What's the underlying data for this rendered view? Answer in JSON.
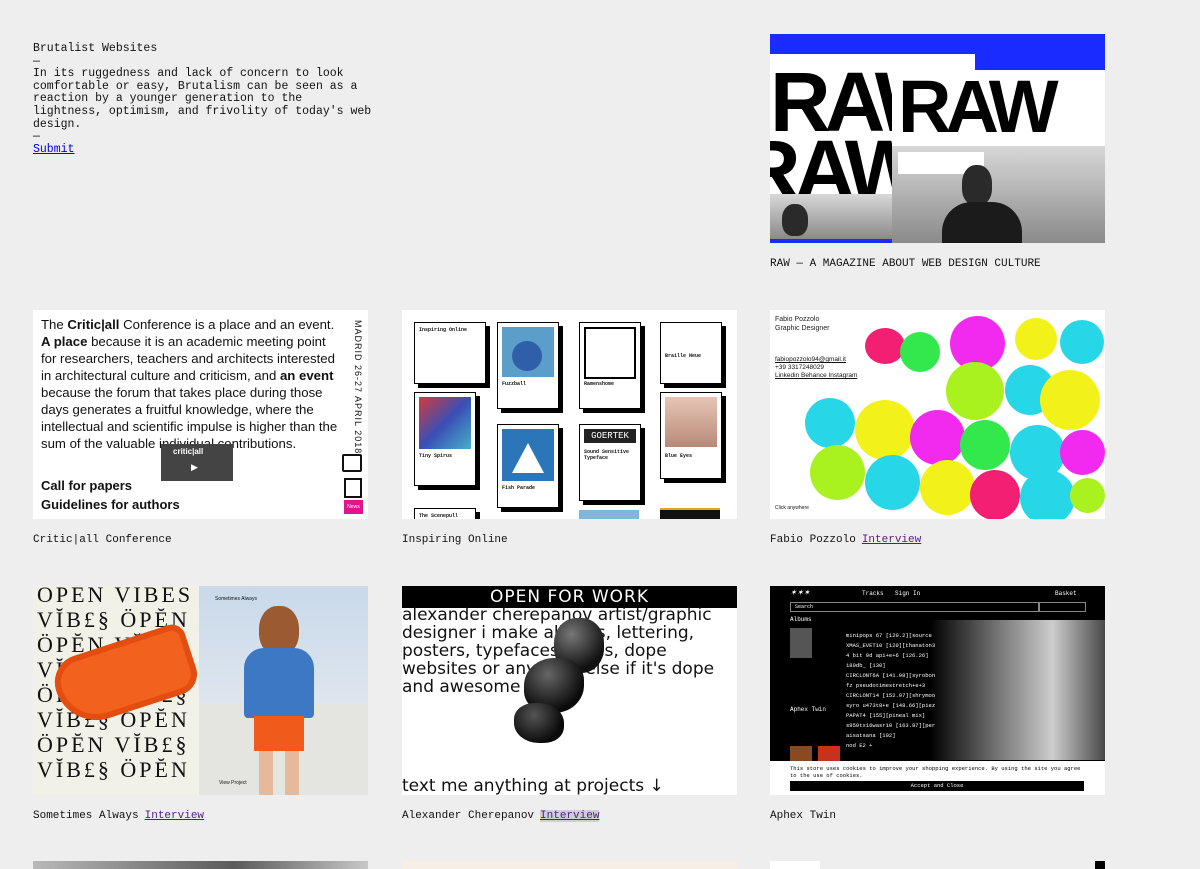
{
  "intro": {
    "title": "Brutalist Websites",
    "dash": "—",
    "description": "In its ruggedness and lack of concern to look comfortable or easy, Brutalism can be seen as a reaction by a younger generation to the lightness, optimism, and frivolity of today's web design.",
    "dash2": "—",
    "submit_label": "Submit"
  },
  "sites": [
    {
      "title": "RAW — A MAGAZINE ABOUT WEB DESIGN CULTURE",
      "interview": ""
    },
    {
      "title": "Critic|all Conference",
      "interview": ""
    },
    {
      "title": "Inspiring Online",
      "interview": ""
    },
    {
      "title": "Fabio Pozzolo",
      "interview": "Interview"
    },
    {
      "title": "Sometimes Always",
      "interview": "Interview"
    },
    {
      "title": "Alexander Cherepanov",
      "interview": "Interview"
    },
    {
      "title": "Aphex Twin",
      "interview": ""
    }
  ],
  "raw": {
    "word": "RAW"
  },
  "critic": {
    "p1a": "The ",
    "p1b": "Critic|all",
    "p1c": " Conference is a place and an event. ",
    "p2a": "A place",
    "p2b": " because it is an academic meeting point for researchers, teachers and architects interested in architectural culture and criticism, and ",
    "p3a": "an event",
    "p3b": " because the forum that takes place during those days generates a fruitful knowledge, where the intellectual and scientific impulse is higher than the sum of the valuable individual contributions.",
    "link1": "Call for papers",
    "link2": "Guidelines for authors",
    "side": "MADRID 26-27 APRIL 2018",
    "video": "critic|all",
    "news": "News"
  },
  "inspiring": {
    "title": "Inspiring Online",
    "boxes": [
      "Fuzzball",
      "Ramenshome",
      "Braille Neue",
      "Tiny Spirus",
      "Fish Parade",
      "Sound Sensitive Typeface",
      "Blue Eyes",
      "The Scenepull"
    ],
    "goertek": "GOERTEK"
  },
  "fabio": {
    "name": "Fabio Pozzolo",
    "role": "Graphic Designer",
    "email": "fabiopozzolo94@gmail.it",
    "phone": "+39 3317248029",
    "links": "Linkedin  Behance  Instagram",
    "click": "Click anywhere"
  },
  "sometimes": {
    "pattern": "OPEN VIBES VĬB£§ ÖPĔN ÖPĔN VĬB£§ VĬB£§ ÖPĔN ÖPĔN VĬB£§ VĬB£§ ÖPĔN ÖPĔN VĬB£§ VĬB£§ ÖPĔN",
    "brand": "Sometimes Always",
    "view": "View Project"
  },
  "alexander": {
    "bar": "OPEN FOR WORK",
    "text": "alexander cherepanov artist/graphic designer i make albums, lettering, posters, typefaces, zines, dope websites or anything else if it's dope and awesome",
    "footer": "text me anything at   projects ↓"
  },
  "aphex": {
    "nav": [
      "Tracks",
      "Sign In",
      "Basket"
    ],
    "search": "Search",
    "albums": "Albums",
    "rows": [
      "minipops 67 [120.2][source",
      "XMAS_EVET10 [120][thanaton3",
      "4 bit 9d api+e+6 [126.26]",
      "180db_ [130]",
      "CIRCLONT6A [141.98][syrobon",
      "fz pseudotimestretch+e+3",
      "CIRCLONT14 [152.97][shrymoo",
      "syro u473t8+e [148.66][piez",
      "PAPAT4 [155][pineal mix]",
      "s950tx16wasr10 [163.97][per",
      "aisatsana [102]",
      "nod E2 +"
    ],
    "artist": "Aphex Twin",
    "cookie": "This store uses cookies to improve your shopping experience. By using the site you agree to the use of cookies.",
    "accept": "Accept and Close"
  }
}
